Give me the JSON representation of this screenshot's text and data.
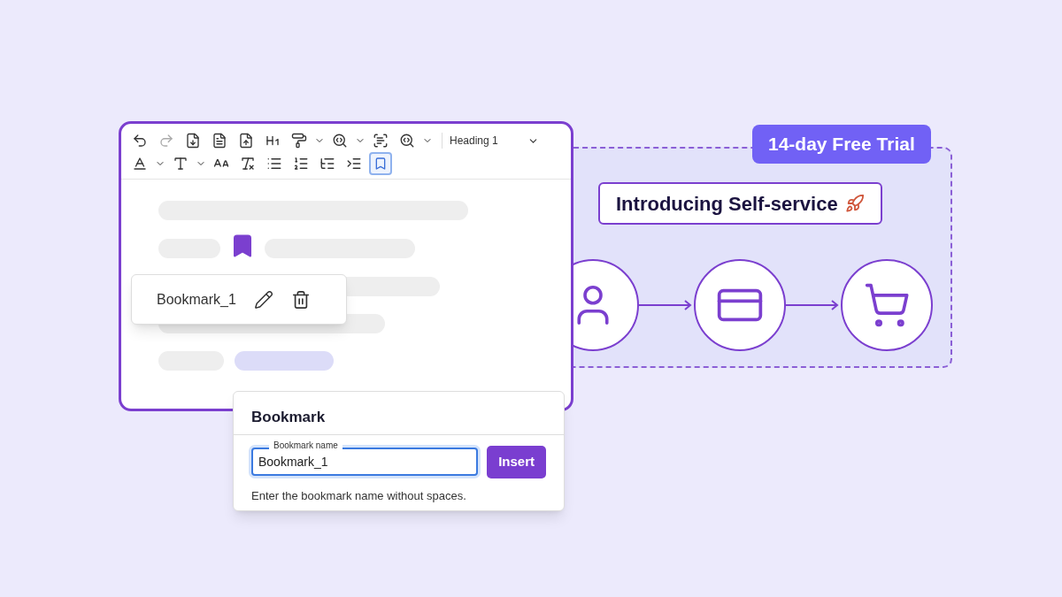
{
  "editor": {
    "toolbar": {
      "style_dropdown": "Heading 1",
      "bookmark_tool_selected": true
    },
    "bookmark_tooltip": {
      "name": "Bookmark_1"
    }
  },
  "bookmark_dialog": {
    "title": "Bookmark",
    "field": {
      "label": "Bookmark name",
      "value": "Bookmark_1"
    },
    "button": "Insert",
    "hint": "Enter the bookmark name without spaces."
  },
  "promo": {
    "badge": "14-day Free Trial",
    "headline": "Introducing Self-service"
  }
}
